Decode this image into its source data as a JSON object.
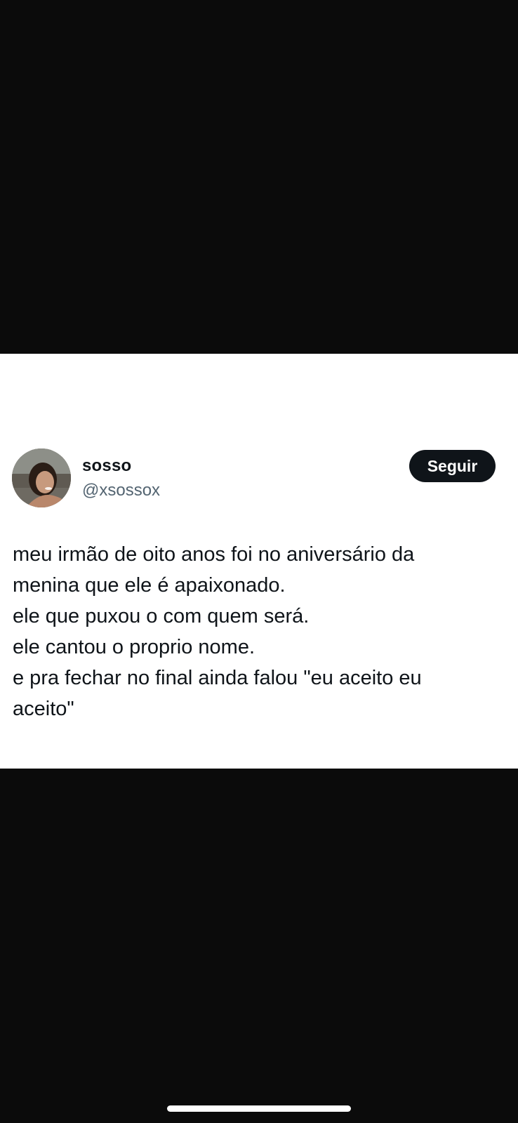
{
  "tweet": {
    "display_name": "sosso",
    "handle": "@xsossox",
    "follow_label": "Seguir",
    "lines": [
      "meu irmão de oito anos foi no aniversário da",
      "menina que ele é apaixonado.",
      "ele que puxou o com quem será.",
      "ele cantou o proprio nome.",
      "e pra fechar no final ainda falou \"eu aceito eu",
      "aceito\""
    ]
  },
  "icons": {
    "avatar": "profile-photo",
    "home_indicator": "home-indicator-bar"
  },
  "colors": {
    "background_dark": "#0b0b0b",
    "card": "#ffffff",
    "text_primary": "#0f1419",
    "text_secondary": "#536471",
    "follow_button": "#0f1419"
  }
}
